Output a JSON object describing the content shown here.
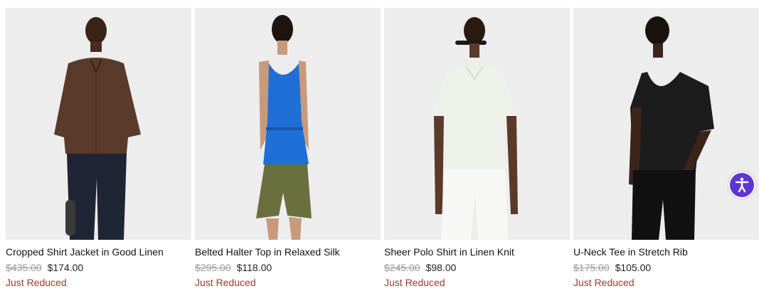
{
  "products": [
    {
      "name": "Cropped Shirt Jacket in Good Linen",
      "old_price": "$435.00",
      "price": "$174.00",
      "badge": "Just Reduced",
      "image_icon": "model-photo-brown-linen-jacket",
      "top_color": "#5a3a2a",
      "bottom_color": "#1f2535"
    },
    {
      "name": "Belted Halter Top in Relaxed Silk",
      "old_price": "$295.00",
      "price": "$118.00",
      "badge": "Just Reduced",
      "image_icon": "model-photo-blue-halter-top",
      "top_color": "#1f6fd6",
      "bottom_color": "#6a6f3e"
    },
    {
      "name": "Sheer Polo Shirt in Linen Knit",
      "old_price": "$245.00",
      "price": "$98.00",
      "badge": "Just Reduced",
      "image_icon": "model-photo-ivory-polo",
      "top_color": "#eef0ea",
      "bottom_color": "#f7f7f5"
    },
    {
      "name": "U-Neck Tee in Stretch Rib",
      "old_price": "$175.00",
      "price": "$105.00",
      "badge": "Just Reduced",
      "image_icon": "model-photo-black-tee",
      "top_color": "#1c1c1c",
      "bottom_color": "#111111"
    }
  ],
  "accessibility_button": {
    "icon": "accessibility-icon",
    "color": "#5f36d4"
  },
  "colors": {
    "badge": "#9b3b2a",
    "old_price": "#9a9a9a"
  }
}
